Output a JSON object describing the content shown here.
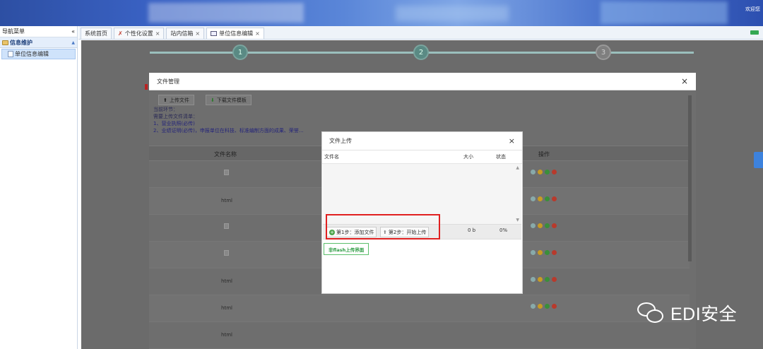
{
  "banner": {
    "corner_text": "欢迎您"
  },
  "nav": {
    "title": "导航菜单",
    "collapse_glyph": "«",
    "group_label": "信息维护",
    "group_toggle_glyph": "▲",
    "item_label": "单位信息编辑"
  },
  "tabs": [
    {
      "label": "系统首页"
    },
    {
      "label": "个性化设置",
      "close": "×"
    },
    {
      "label": "站内信箱",
      "close": "×"
    },
    {
      "label": "单位信息编辑",
      "close": "×"
    }
  ],
  "steps": {
    "one": "1",
    "two": "2",
    "three": "3"
  },
  "file_manager": {
    "title": "文件管理",
    "close": "×",
    "upload_btn": "上传文件",
    "download_btn": "下载文件模板",
    "note_line1": "当前环节：",
    "note_line2": "需要上传文件清单：",
    "note_line3": "1、营业执照(必传)",
    "note_line4": "2、业绩证明(必传)，申报单位在科技、标准编制方面的成果、荣誉...",
    "col_filename": "文件名称",
    "col_ops": "操作",
    "rows": [
      {
        "name": ""
      },
      {
        "name": "html"
      },
      {
        "name": ""
      },
      {
        "name": ""
      },
      {
        "name": "html"
      },
      {
        "name": "html"
      },
      {
        "name": "html"
      }
    ]
  },
  "upload_dialog": {
    "title": "文件上传",
    "close": "×",
    "col_filename": "文件名",
    "col_size": "大小",
    "col_status": "状态",
    "step1": "第1步：添加文件",
    "step2": "第2步：开始上传",
    "size_value": "0 b",
    "status_value": "0%",
    "noflash_btn": "非flash上传界面",
    "scroll_up": "▲",
    "scroll_down": "▼"
  },
  "watermark": {
    "text": "EDI安全"
  },
  "colors": {
    "accent_red": "#e02020",
    "banner_blue": "#3a62c4",
    "button_green": "#2c9b42"
  }
}
